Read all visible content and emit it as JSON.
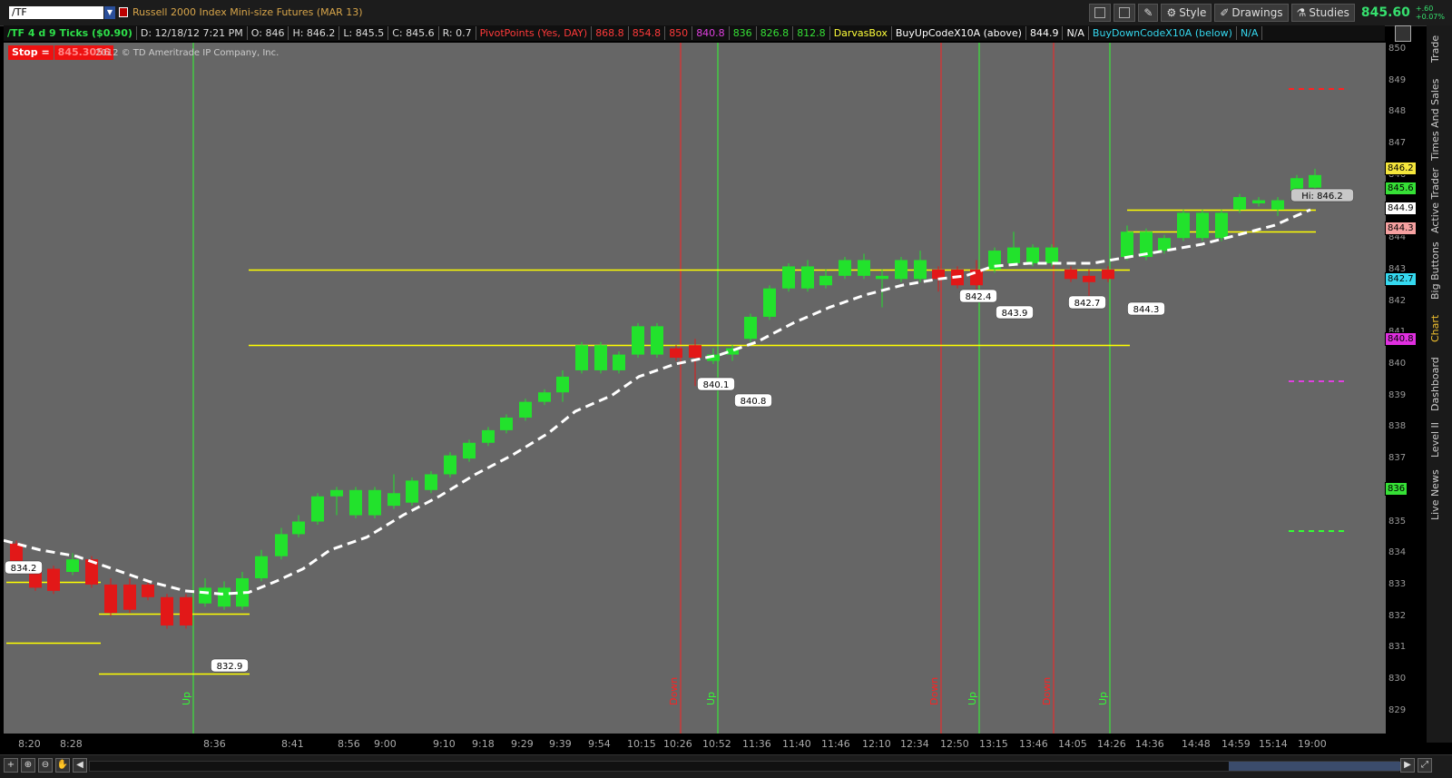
{
  "top": {
    "symbol": "/TF",
    "title": "Russell 2000 Index Mini-size Futures (MAR 13)",
    "style_label": "Style",
    "drawings_label": "Drawings",
    "studies_label": "Studies",
    "last_price": "845.60",
    "net_change": "+.60",
    "pct_change": "+0.07%"
  },
  "info": {
    "series": "/TF 4 d 9 Ticks ($0.90)",
    "date": "D: 12/18/12 7:21 PM",
    "open": "O: 846",
    "high": "H: 846.2",
    "low": "L: 845.5",
    "close": "C: 845.6",
    "range": "R: 0.7",
    "pivot_label": "PivotPoints (Yes, DAY)",
    "pivots": [
      "868.8",
      "854.8",
      "850",
      "840.8",
      "836",
      "826.8",
      "812.8"
    ],
    "darvas": "DarvasBox",
    "buyup": "BuyUpCodeX10A (above)",
    "buyup_val": "844.9",
    "buyup_na": "N/A",
    "buydown": "BuyDownCodeX10A (below)",
    "buydown_na": "N/A"
  },
  "plot": {
    "stop_label": "Stop =",
    "stop_value": "845.3056",
    "copyright": "2012 © TD Ameritrade IP Company, Inc."
  },
  "price_axis": {
    "ticks": [
      "850",
      "849",
      "848",
      "847",
      "846",
      "845",
      "844",
      "843",
      "842",
      "841",
      "840",
      "839",
      "838",
      "837",
      "836",
      "835",
      "834",
      "833",
      "832",
      "831",
      "830",
      "829"
    ],
    "badges": [
      {
        "text": "846.2",
        "color": "#f5e63c"
      },
      {
        "text": "845.6",
        "color": "#36e036"
      },
      {
        "text": "844.9",
        "color": "#ffffff"
      },
      {
        "text": "844.3",
        "color": "#f6a1a1"
      },
      {
        "text": "842.7",
        "color": "#35d9f0"
      },
      {
        "text": "840.8",
        "color": "#e02fe0"
      },
      {
        "text": "836",
        "color": "#36e036"
      }
    ]
  },
  "time_axis": [
    "8:20",
    "8:28",
    "8:36",
    "8:41",
    "8:56",
    "9:00",
    "9:10",
    "9:18",
    "9:29",
    "9:39",
    "9:54",
    "10:15",
    "10:26",
    "10:52",
    "11:36",
    "11:40",
    "11:46",
    "12:10",
    "12:34",
    "12:50",
    "13:15",
    "13:46",
    "14:05",
    "14:26",
    "14:36",
    "14:48",
    "14:59",
    "15:14",
    "19:00"
  ],
  "markers": {
    "up": "Up",
    "down": "Down"
  },
  "callouts": [
    "834.2",
    "832.9",
    "840.1",
    "840.8",
    "842.4",
    "843.9",
    "842.7",
    "844.3",
    "Hi: 846.2"
  ],
  "side_tabs": [
    "Trade",
    "Times And Sales",
    "Active Trader",
    "Big Buttons",
    "Chart",
    "Dashboard",
    "Level II",
    "Live News"
  ],
  "colors": {
    "up_candle": "#22e22c",
    "down_candle": "#e21818",
    "box_line": "#ffff00",
    "ma_line": "#ffffff",
    "plot_bg": "#666666"
  }
}
